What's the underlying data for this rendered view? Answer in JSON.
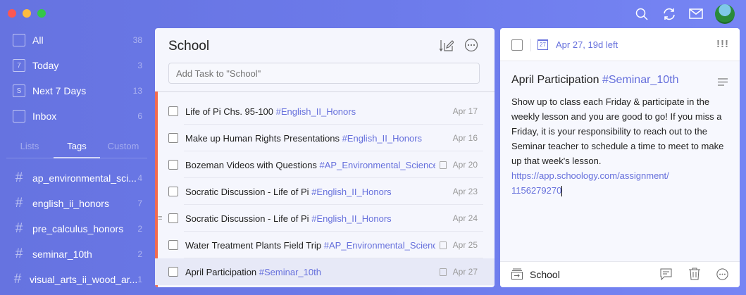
{
  "window": {
    "traffic_lights": [
      "#fc5753",
      "#fdbc40",
      "#33c748"
    ]
  },
  "toolbar": {
    "icons": [
      "search-icon",
      "sync-icon",
      "mail-icon",
      "avatar"
    ]
  },
  "sidebar": {
    "smart_lists": [
      {
        "label": "All",
        "count": "38",
        "icon": "stack-icon"
      },
      {
        "label": "Today",
        "count": "3",
        "icon": "7"
      },
      {
        "label": "Next 7 Days",
        "count": "13",
        "icon": "S"
      },
      {
        "label": "Inbox",
        "count": "6",
        "icon": "inbox-icon"
      }
    ],
    "tabs": [
      "Lists",
      "Tags",
      "Custom"
    ],
    "active_tab": "Tags",
    "tags": [
      {
        "label": "ap_environmental_sci...",
        "count": "4"
      },
      {
        "label": "english_ii_honors",
        "count": "7"
      },
      {
        "label": "pre_calculus_honors",
        "count": "2"
      },
      {
        "label": "seminar_10th",
        "count": "2"
      },
      {
        "label": "visual_arts_ii_wood_ar...",
        "count": "1"
      }
    ]
  },
  "list": {
    "title": "School",
    "add_placeholder": "Add Task to \"School\"",
    "accent": "#f26b4f",
    "tasks": [
      {
        "title": "Life of Pi Chs. 95-100 ",
        "tag": "#English_II_Honors",
        "date": "Apr 17",
        "note": false
      },
      {
        "title": "Make up Human Rights Presentations ",
        "tag": "#English_II_Honors",
        "date": "Apr 16",
        "note": false
      },
      {
        "title": "Bozeman Videos with Questions ",
        "tag": "#AP_Environmental_Science",
        "date": "Apr 20",
        "note": true
      },
      {
        "title": "Socratic Discussion - Life of Pi ",
        "tag": "#English_II_Honors",
        "date": "Apr 23",
        "note": false
      },
      {
        "title": "Socratic Discussion - Life of Pi ",
        "tag": "#English_II_Honors",
        "date": "Apr 24",
        "note": false
      },
      {
        "title": "Water Treatment Plants Field Trip ",
        "tag": "#AP_Environmental_Science",
        "date": "Apr 25",
        "note": true
      },
      {
        "title": "April Participation ",
        "tag": "#Seminar_10th",
        "date": "Apr 27",
        "note": true
      }
    ]
  },
  "detail": {
    "calendar_day": "27",
    "due": "Apr 27, 19d left",
    "priority": "!!!",
    "title": "April Participation ",
    "tag": "#Seminar_10th",
    "body": "Show up to class each Friday & participate in the weekly lesson and you are good to go! If you miss a Friday, it is your responsibility to reach out to the Seminar teacher to schedule a time to meet to make up that week's lesson.",
    "link_line1": "https://app.schoology.com/assignment/",
    "link_line2": "1156279270",
    "list_name": "School"
  }
}
